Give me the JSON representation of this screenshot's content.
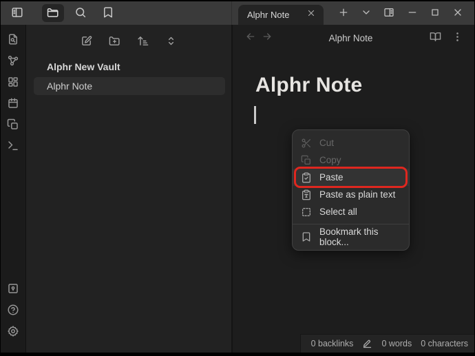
{
  "topbar": {
    "left_icons": [
      "panel-left-toggle",
      "folder",
      "search",
      "bookmark"
    ],
    "active_icon": "folder"
  },
  "tabbar": {
    "tab_title": "Alphr Note",
    "controls": [
      "close-tab",
      "new-tab",
      "tab-list",
      "panel-right-toggle",
      "minimize",
      "maximize",
      "close-window"
    ]
  },
  "view_header": {
    "title": "Alphr Note",
    "left_icons": [
      "back-arrow",
      "forward-arrow"
    ],
    "right_icons": [
      "reading-view-book",
      "more-options"
    ]
  },
  "ribbon": {
    "top_icons": [
      "quick-switcher-file-search",
      "graph-view",
      "canvas",
      "daily-note-calendar",
      "templates-copy",
      "command-palette-terminal"
    ],
    "bottom_icons": [
      "vault-switcher",
      "help",
      "settings-gear"
    ]
  },
  "explorer": {
    "actions": [
      "new-note",
      "new-folder",
      "sort-order",
      "collapse-all"
    ],
    "vault_title": "Alphr New Vault",
    "files": [
      {
        "name": "Alphr Note",
        "selected": true
      }
    ]
  },
  "editor": {
    "heading": "Alphr Note"
  },
  "context_menu": {
    "items": [
      {
        "label": "Cut",
        "icon": "scissors",
        "disabled": true,
        "highlighted": false
      },
      {
        "label": "Copy",
        "icon": "copy",
        "disabled": true,
        "highlighted": false
      },
      {
        "label": "Paste",
        "icon": "clipboard-check",
        "disabled": false,
        "highlighted": true
      },
      {
        "label": "Paste as plain text",
        "icon": "clipboard-type",
        "disabled": false,
        "highlighted": false
      },
      {
        "label": "Select all",
        "icon": "box-select",
        "disabled": false,
        "highlighted": false
      }
    ],
    "footer_items": [
      {
        "label": "Bookmark this block...",
        "icon": "bookmark"
      }
    ],
    "annotation_color": "#df271f"
  },
  "status_bar": {
    "backlinks": "0 backlinks",
    "edit_icon": "pencil",
    "words": "0 words",
    "characters": "0 characters"
  },
  "colors": {
    "topbar_bg": "#3a3a3a",
    "editor_bg": "#1d1d1d",
    "explorer_bg": "#222222",
    "menu_bg": "#2b2b2b",
    "annotation_red": "#df271f"
  }
}
